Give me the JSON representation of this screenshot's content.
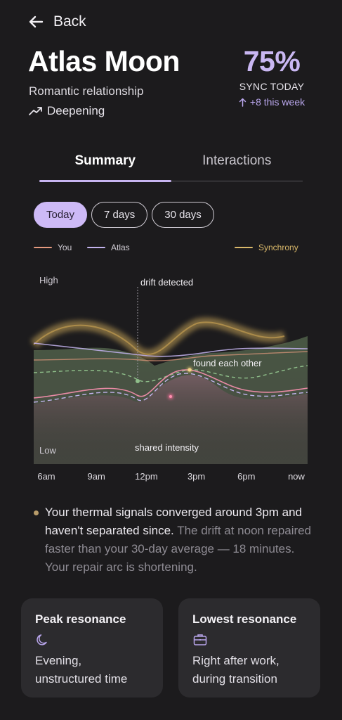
{
  "nav": {
    "back_label": "Back"
  },
  "profile": {
    "name": "Atlas Moon",
    "relationship": "Romantic relationship",
    "trend": "Deepening"
  },
  "sync": {
    "percent": "75%",
    "label": "SYNC TODAY",
    "week_change": "+8 this week"
  },
  "tabs": [
    {
      "label": "Summary",
      "active": true
    },
    {
      "label": "Interactions",
      "active": false
    }
  ],
  "ranges": [
    {
      "label": "Today",
      "active": true
    },
    {
      "label": "7 days",
      "active": false
    },
    {
      "label": "30 days",
      "active": false
    }
  ],
  "legend": {
    "you": "You",
    "atlas": "Atlas",
    "synchrony": "Synchrony"
  },
  "colors": {
    "you": "#e59a7e",
    "atlas": "#c3b3ee",
    "synchrony": "#d9b86a",
    "accent": "#cdb9f6"
  },
  "chart_data": {
    "type": "area",
    "ylabel_high": "High",
    "ylabel_low": "Low",
    "x": [
      "6am",
      "9am",
      "12pm",
      "3pm",
      "6pm",
      "now"
    ],
    "annotations": {
      "drift": "drift detected",
      "found": "found each other",
      "shared": "shared intensity"
    }
  },
  "insight": {
    "highlight": "Your thermal signals converged around 3pm and haven't separated since.",
    "detail": "The drift at noon repaired faster than your 30-day average — 18 minutes. Your repair arc is shortening."
  },
  "cards": [
    {
      "title": "Peak resonance",
      "icon": "moon-icon",
      "text": "Evening, unstructured time"
    },
    {
      "title": "Lowest resonance",
      "icon": "briefcase-icon",
      "text": "Right after work, during transition"
    }
  ]
}
